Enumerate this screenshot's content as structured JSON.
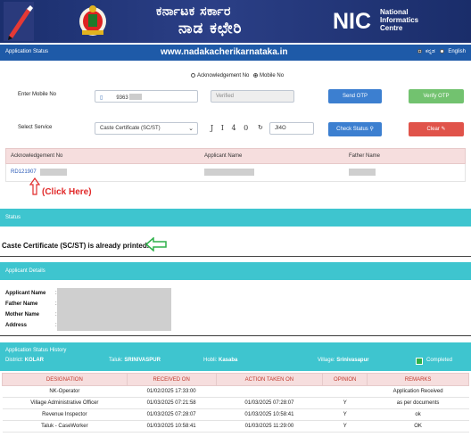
{
  "header": {
    "kannada_line1": "ಕರ್ನಾಟಕ ಸರ್ಕಾರ",
    "kannada_line2": "ನಾಡ ಕಛೇರಿ",
    "nic_logo": "NIC",
    "nic_line1": "National",
    "nic_line2": "Informatics",
    "nic_line3": "Centre"
  },
  "topbar": {
    "label": "Application Status",
    "site": "www.nadakacherikarnataka.in",
    "lang_kannada": "ಕನ್ನಡ",
    "lang_english": "English"
  },
  "form": {
    "radio_ack": "Acknowledgement No",
    "radio_mobile": "Mobile No",
    "mobile_label": "Enter Mobile No",
    "mobile_value": "9363",
    "verified_placeholder": "Verified",
    "send_otp": "Send OTP",
    "verify_otp": "Verify OTP",
    "service_label": "Select Service",
    "service_value": "Caste Certificate (SC/ST)",
    "captcha_text": "J I 4 0",
    "captcha_input": "JI4O",
    "check_status": "Check Status",
    "clear": "Clear"
  },
  "results": {
    "headers": [
      "Acknowledgement No",
      "Applicant Name",
      "Father Name"
    ],
    "ack_prefix": "RD121907",
    "click_here": "(Click Here)"
  },
  "status": {
    "title": "Status",
    "message": "Caste Certificate (SC/ST) is already printed."
  },
  "applicant": {
    "title": "Applicant Details",
    "fields": [
      "Applicant Name",
      "Father Name",
      "Mother Name",
      "Address"
    ]
  },
  "history": {
    "title": "Application Status History",
    "district_label": "District:",
    "district": "KOLAR",
    "taluk_label": "Taluk:",
    "taluk": "SRINIVASPUR",
    "hobli_label": "Hobli:",
    "hobli": "Kasaba",
    "village_label": "Village:",
    "village": "Srinivasapur",
    "legend": "Completed",
    "columns": [
      "DESIGNATION",
      "RECEIVED ON",
      "ACTION TAKEN ON",
      "OPINION",
      "REMARKS"
    ],
    "rows": [
      [
        "NK-Operator",
        "01/02/2025 17:33:00",
        "",
        "",
        "Application Received"
      ],
      [
        "Village Administrative Officer",
        "01/03/2025 07:21:58",
        "01/03/2025 07:28:07",
        "Y",
        "as per documents"
      ],
      [
        "Revenue Inspector",
        "01/03/2025 07:28:07",
        "01/03/2025 10:58:41",
        "Y",
        "ok"
      ],
      [
        "Taluk - CaseWorker",
        "01/03/2025 10:58:41",
        "01/03/2025 11:29:00",
        "Y",
        "OK"
      ]
    ]
  },
  "colors": {
    "banner": "#1b2f6e",
    "topbar": "#1e5aa8",
    "section": "#3ec5cf",
    "table_head": "#f6dede",
    "click_here": "#e12a2a"
  }
}
